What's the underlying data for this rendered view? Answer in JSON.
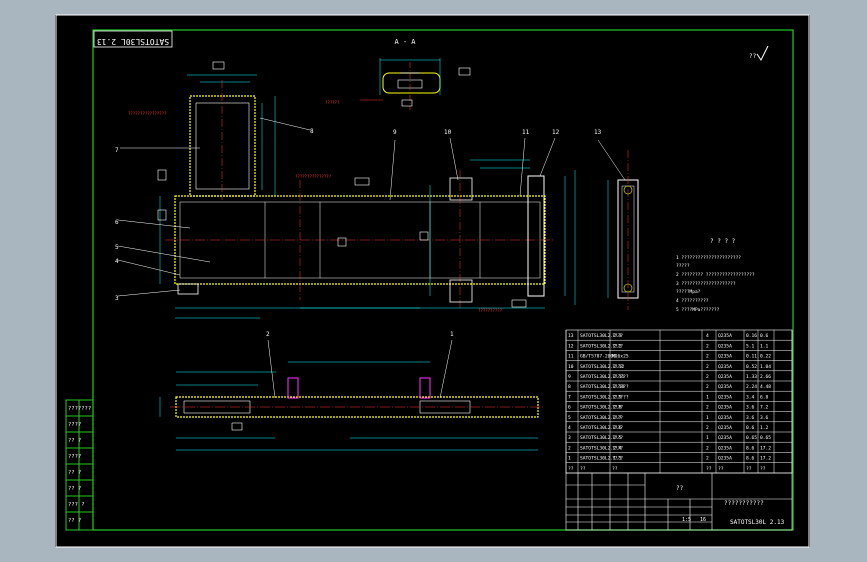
{
  "drawing": {
    "code_stamp": "SATOTSL30L 2.13",
    "section_label": "A - A",
    "roughness_mark": "??",
    "notes_title": "? ? ? ?",
    "notes": [
      "1 ??????????????????????",
      "  ?????",
      "2 ???????? ??????????????????",
      "3 ????????????????????",
      "  ?????Mpa?",
      "4 ??????????",
      "5 ????MPa???????"
    ],
    "part_refs": [
      "1",
      "2",
      "3",
      "4",
      "5",
      "6",
      "7",
      "8",
      "9",
      "10",
      "11",
      "12",
      "13"
    ],
    "left_dims": [
      "???????"
    ],
    "annotations": [
      "????????????????",
      "???????????????",
      "??????????"
    ]
  },
  "bom": {
    "rows": [
      {
        "no": "13",
        "code": "SATOTSL30L2.2.3",
        "name": "????",
        "qty": "4",
        "mat": "Q235A",
        "w1": "0.16",
        "w2": "0.6"
      },
      {
        "no": "12",
        "code": "SATOTSL30L2.2.2",
        "name": "????",
        "qty": "2",
        "mat": "Q235A",
        "w1": "5.1",
        "w2": "1.1"
      },
      {
        "no": "11",
        "code": "GB/T5787-2000",
        "name": "M16x25",
        "qty": "2",
        "mat": "Q235A",
        "w1": "0.11",
        "w2": "0.22"
      },
      {
        "no": "10",
        "code": "SATOTSL30L2.2.12",
        "name": "????",
        "qty": "2",
        "mat": "Q235A",
        "w1": "0.52",
        "w2": "1.04"
      },
      {
        "no": "9",
        "code": "SATOTSL30L2.2.11",
        "name": "??????",
        "qty": "2",
        "mat": "Q235A",
        "w1": "1.33",
        "w2": "2.66"
      },
      {
        "no": "8",
        "code": "SATOTSL30L2.2.10",
        "name": "??????",
        "qty": "2",
        "mat": "Q235A",
        "w1": "2.24",
        "w2": "4.48"
      },
      {
        "no": "7",
        "code": "SATOTSL30L2.2.9",
        "name": "??????",
        "qty": "1",
        "mat": "Q235A",
        "w1": "3.4",
        "w2": "6.8"
      },
      {
        "no": "6",
        "code": "SATOTSL30L2.2.8",
        "name": "????",
        "qty": "2",
        "mat": "Q235A",
        "w1": "3.6",
        "w2": "7.2"
      },
      {
        "no": "5",
        "code": "SATOTSL30L2.2.7",
        "name": "????",
        "qty": "1",
        "mat": "Q235A",
        "w1": "3.6",
        "w2": "3.6"
      },
      {
        "no": "4",
        "code": "SATOTSL30L2.2.6",
        "name": "????",
        "qty": "2",
        "mat": "Q235A",
        "w1": "0.6",
        "w2": "1.2"
      },
      {
        "no": "3",
        "code": "SATOTSL30L2.2.5",
        "name": "????",
        "qty": "1",
        "mat": "Q235A",
        "w1": "0.65",
        "w2": "0.65"
      },
      {
        "no": "2",
        "code": "SATOTSL30L2.2.4",
        "name": "????",
        "qty": "2",
        "mat": "Q235A",
        "w1": "8.6",
        "w2": "17.2"
      },
      {
        "no": "1",
        "code": "SATOTSL30L2.1.1",
        "name": "????",
        "qty": "2",
        "mat": "Q235A",
        "w1": "8.6",
        "w2": "17.2"
      }
    ],
    "header": {
      "no": "??",
      "code": "??",
      "name": "??",
      "qty": "??",
      "mat": "??",
      "w1": "??",
      "w2": "??"
    }
  },
  "title_block": {
    "part_name": "??",
    "company": "???????????",
    "drawing_no": "SATOTSL30L 2.13",
    "scale": "1:5",
    "sheet": "?",
    "weight": "16"
  },
  "revision_column": [
    "???????",
    "????",
    "?? ?",
    "????",
    "?? ?",
    "?? ?",
    "??? ?",
    "?? ?"
  ]
}
